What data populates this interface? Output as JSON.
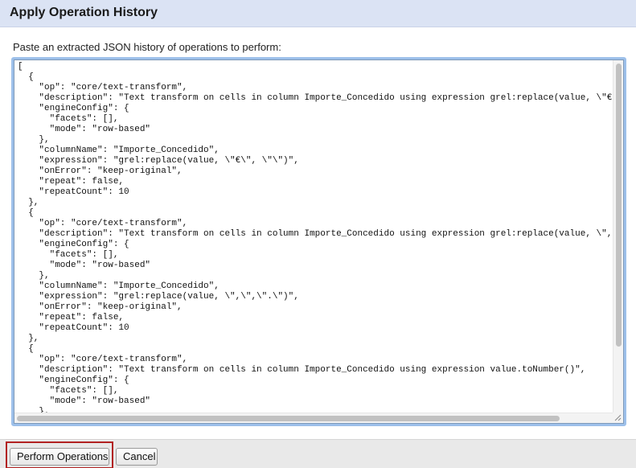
{
  "dialog": {
    "title": "Apply Operation History",
    "instructions": "Paste an extracted JSON history of operations to perform:"
  },
  "editor": {
    "content": "[\n  {\n    \"op\": \"core/text-transform\",\n    \"description\": \"Text transform on cells in column Importe_Concedido using expression grel:replace(value, \\\"€\\\n    \"engineConfig\": {\n      \"facets\": [],\n      \"mode\": \"row-based\"\n    },\n    \"columnName\": \"Importe_Concedido\",\n    \"expression\": \"grel:replace(value, \\\"€\\\", \\\"\\\")\",\n    \"onError\": \"keep-original\",\n    \"repeat\": false,\n    \"repeatCount\": 10\n  },\n  {\n    \"op\": \"core/text-transform\",\n    \"description\": \"Text transform on cells in column Importe_Concedido using expression grel:replace(value, \\\",\\\n    \"engineConfig\": {\n      \"facets\": [],\n      \"mode\": \"row-based\"\n    },\n    \"columnName\": \"Importe_Concedido\",\n    \"expression\": \"grel:replace(value, \\\",\\\",\\\".\\\")\",\n    \"onError\": \"keep-original\",\n    \"repeat\": false,\n    \"repeatCount\": 10\n  },\n  {\n    \"op\": \"core/text-transform\",\n    \"description\": \"Text transform on cells in column Importe_Concedido using expression value.toNumber()\",\n    \"engineConfig\": {\n      \"facets\": [],\n      \"mode\": \"row-based\"\n    },"
  },
  "footer": {
    "perform_label": "Perform Operations",
    "cancel_label": "Cancel"
  }
}
